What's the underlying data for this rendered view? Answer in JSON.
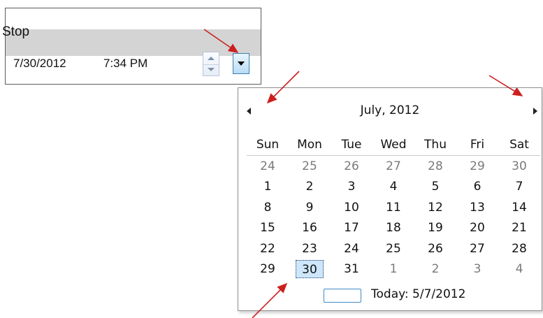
{
  "stop_panel": {
    "title": "Stop",
    "date_value": "7/30/2012",
    "time_value": "7:34 PM"
  },
  "calendar": {
    "month_title": "July, 2012",
    "days_of_week": [
      "Sun",
      "Mon",
      "Tue",
      "Wed",
      "Thu",
      "Fri",
      "Sat"
    ],
    "weeks": [
      [
        {
          "d": "24",
          "other": true
        },
        {
          "d": "25",
          "other": true
        },
        {
          "d": "26",
          "other": true
        },
        {
          "d": "27",
          "other": true
        },
        {
          "d": "28",
          "other": true
        },
        {
          "d": "29",
          "other": true
        },
        {
          "d": "30",
          "other": true
        }
      ],
      [
        {
          "d": "1"
        },
        {
          "d": "2"
        },
        {
          "d": "3"
        },
        {
          "d": "4"
        },
        {
          "d": "5"
        },
        {
          "d": "6"
        },
        {
          "d": "7"
        }
      ],
      [
        {
          "d": "8"
        },
        {
          "d": "9"
        },
        {
          "d": "10"
        },
        {
          "d": "11"
        },
        {
          "d": "12"
        },
        {
          "d": "13"
        },
        {
          "d": "14"
        }
      ],
      [
        {
          "d": "15"
        },
        {
          "d": "16"
        },
        {
          "d": "17"
        },
        {
          "d": "18"
        },
        {
          "d": "19"
        },
        {
          "d": "20"
        },
        {
          "d": "21"
        }
      ],
      [
        {
          "d": "22"
        },
        {
          "d": "23"
        },
        {
          "d": "24"
        },
        {
          "d": "25"
        },
        {
          "d": "26"
        },
        {
          "d": "27"
        },
        {
          "d": "28"
        }
      ],
      [
        {
          "d": "29"
        },
        {
          "d": "30",
          "selected": true
        },
        {
          "d": "31"
        },
        {
          "d": "1",
          "other": true
        },
        {
          "d": "2",
          "other": true
        },
        {
          "d": "3",
          "other": true
        },
        {
          "d": "4",
          "other": true
        }
      ]
    ],
    "today_label": "Today: 5/7/2012"
  },
  "colors": {
    "header_gray": "#d4d4d4",
    "selected_fill": "#cde6fb",
    "today_border": "#3e89c9",
    "annotation_arrow": "#cc1f1f",
    "other_month_text": "#7a7a7a"
  },
  "icons": {
    "spinner": "up-down-spinner-icon",
    "dropdown": "chevron-down-icon",
    "prev_month": "triangle-left-icon",
    "next_month": "triangle-right-icon"
  }
}
